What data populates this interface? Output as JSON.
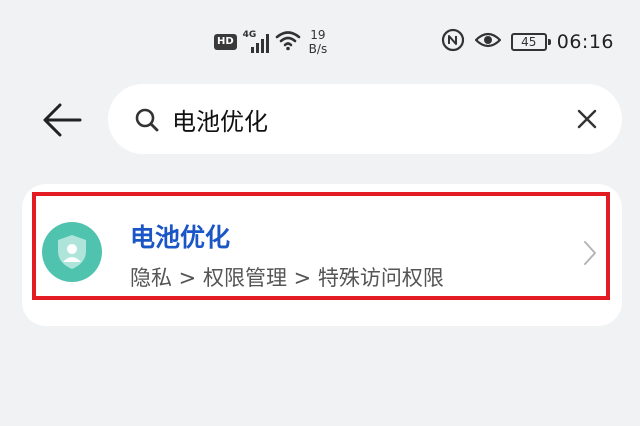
{
  "status_bar": {
    "hd_label": "HD",
    "network_label": "4G",
    "net_speed_value": "19",
    "net_speed_unit": "B/s",
    "battery_level": "45",
    "time": "06:16",
    "icons": [
      "hd-icon",
      "signal-icon",
      "wifi-icon",
      "nfc-icon",
      "eye-icon",
      "battery-icon"
    ]
  },
  "header": {
    "back_icon": "arrow-left-icon",
    "search": {
      "value": "电池优化",
      "search_icon": "search-icon",
      "clear_icon": "close-icon"
    }
  },
  "results": [
    {
      "title": "电池优化",
      "path": "隐私 > 权限管理 > 特殊访问权限",
      "icon": "shield-user-icon",
      "chevron": "chevron-right-icon"
    }
  ],
  "colors": {
    "background": "#f1f2f4",
    "title_blue": "#1a56c6",
    "icon_teal": "#4fc3ae",
    "highlight_red": "#e31b23"
  }
}
